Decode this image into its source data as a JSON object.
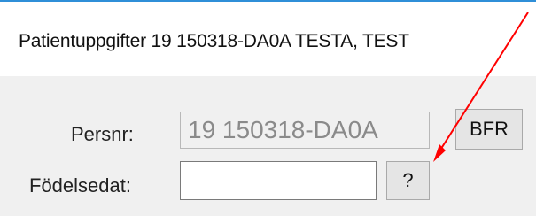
{
  "window": {
    "title": "Patientuppgifter 19 150318-DA0A TESTA, TEST"
  },
  "form": {
    "persnr_label": "Persnr:",
    "persnr_value": "19 150318-DA0A",
    "bfr_button_label": "BFR",
    "fodelsedat_label": "Födelsedat:",
    "fodelsedat_value": "",
    "help_button_label": "?"
  },
  "colors": {
    "window_border": "#2f8fd8",
    "client_background": "#f0f0f0",
    "annotation_arrow": "#ff0000"
  }
}
